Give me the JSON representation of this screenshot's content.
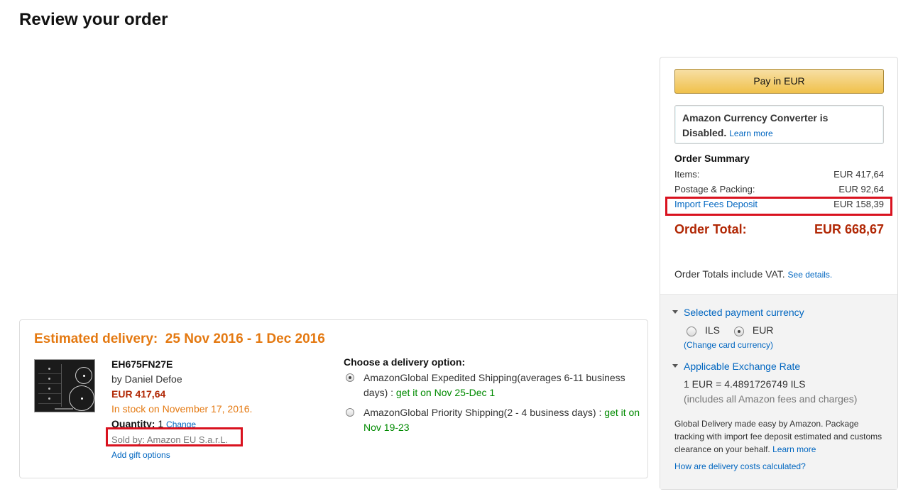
{
  "page": {
    "title": "Review your order"
  },
  "delivery": {
    "estimated": "Estimated delivery:  25 Nov 2016 - 1 Dec 2016",
    "product": {
      "title": "EH675FN27E",
      "author": "by Daniel Defoe",
      "price": "EUR 417,64",
      "stock": "In stock on November 17, 2016.",
      "quantity_label": "Quantity:",
      "quantity_value": "1",
      "change_link": "Change",
      "sold_by": "Sold by: Amazon EU S.a.r.L.",
      "gift_link": "Add gift options"
    },
    "options_heading": "Choose a delivery option:",
    "options": [
      {
        "label": "AmazonGlobal Expedited Shipping(averages 6-11 business days)",
        "sep": " : ",
        "eta": "get it on Nov 25-Dec 1",
        "selected": true
      },
      {
        "label": "AmazonGlobal Priority Shipping(2 - 4 business days)",
        "sep": " : ",
        "eta": "get it on Nov 19-23",
        "selected": false
      }
    ]
  },
  "sidebar": {
    "pay_button": "Pay in EUR",
    "converter_text": "Amazon Currency Converter is Disabled.",
    "converter_link": "Learn more",
    "summary_title": "Order Summary",
    "items_label": "Items:",
    "items_value": "EUR 417,64",
    "postage_label": "Postage & Packing:",
    "postage_value": "EUR 92,64",
    "import_label": "Import Fees Deposit",
    "import_value": "EUR 158,39",
    "total_label": "Order Total:",
    "total_value": "EUR 668,67",
    "vat_text": "Order Totals include VAT.",
    "vat_link": "See details.",
    "currency_heading": "Selected payment currency",
    "currency_options": [
      {
        "label": "ILS",
        "selected": false
      },
      {
        "label": "EUR",
        "selected": true
      }
    ],
    "change_card": "(Change card currency)",
    "exchange_heading": "Applicable Exchange Rate",
    "exchange_rate": "1 EUR = 4.4891726749 ILS",
    "exchange_note": "(includes all Amazon fees and charges)",
    "global_note": "Global Delivery made easy by Amazon. Package tracking with import fee deposit estimated and customs clearance on your behalf.",
    "global_link": "Learn more",
    "delivery_cost_link": "How are delivery costs calculated?"
  },
  "colors": {
    "accent_orange": "#e47911",
    "price_red": "#b12704",
    "link_blue": "#0066c0",
    "eta_green": "#008a00",
    "highlight_red": "#d9121f"
  }
}
